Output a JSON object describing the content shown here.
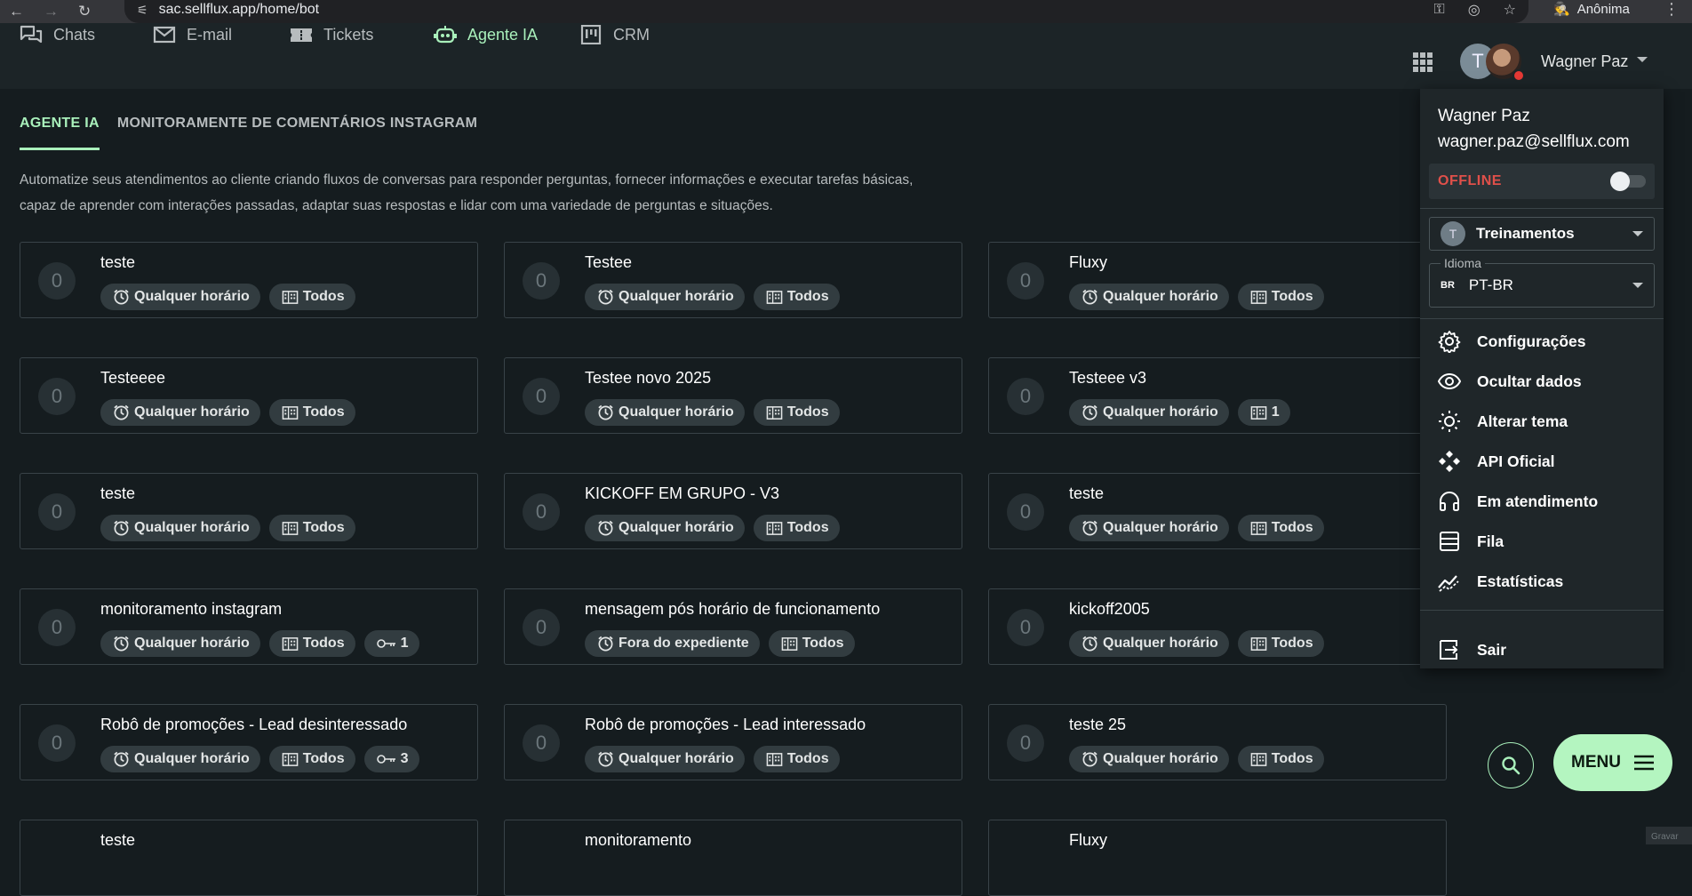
{
  "browser": {
    "url": "sac.sellflux.app/home/bot",
    "incognito_label": "Anônima"
  },
  "nav": {
    "items": [
      {
        "label": "Chats",
        "icon": "chat-icon"
      },
      {
        "label": "E-mail",
        "icon": "mail-icon"
      },
      {
        "label": "Tickets",
        "icon": "ticket-icon"
      },
      {
        "label": "Agente IA",
        "icon": "robot-icon",
        "active": true
      },
      {
        "label": "CRM",
        "icon": "kanban-icon"
      }
    ],
    "user_initial": "T",
    "user_name": "Wagner Paz"
  },
  "tabs": [
    {
      "label": "AGENTE IA",
      "active": true
    },
    {
      "label": "MONITORAMENTE DE COMENTÁRIOS INSTAGRAM",
      "active": false
    }
  ],
  "description": {
    "line1": "Automatize seus atendimentos ao cliente criando fluxos de conversas para responder perguntas, fornecer informações e executar tarefas básicas,",
    "line2": "capaz de aprender com interações passadas, adaptar suas respostas e lidar com uma variedade de perguntas e situações."
  },
  "cards": [
    {
      "count": "0",
      "name": "teste",
      "schedule": "Qualquer horário",
      "scope": "Todos",
      "keys": null
    },
    {
      "count": "0",
      "name": "Testee",
      "schedule": "Qualquer horário",
      "scope": "Todos",
      "keys": null
    },
    {
      "count": "0",
      "name": "Fluxy",
      "schedule": "Qualquer horário",
      "scope": "Todos",
      "keys": null
    },
    {
      "count": "0",
      "name": "Testeeee",
      "schedule": "Qualquer horário",
      "scope": "Todos",
      "keys": null
    },
    {
      "count": "0",
      "name": "Testee novo 2025",
      "schedule": "Qualquer horário",
      "scope": "Todos",
      "keys": null
    },
    {
      "count": "0",
      "name": "Testeee v3",
      "schedule": "Qualquer horário",
      "scope": "1",
      "keys": null
    },
    {
      "count": "0",
      "name": "teste",
      "schedule": "Qualquer horário",
      "scope": "Todos",
      "keys": null
    },
    {
      "count": "0",
      "name": "KICKOFF EM GRUPO - V3",
      "schedule": "Qualquer horário",
      "scope": "Todos",
      "keys": null
    },
    {
      "count": "0",
      "name": "teste",
      "schedule": "Qualquer horário",
      "scope": "Todos",
      "keys": null
    },
    {
      "count": "0",
      "name": "monitoramento instagram",
      "schedule": "Qualquer horário",
      "scope": "Todos",
      "keys": "1"
    },
    {
      "count": "0",
      "name": "mensagem pós horário de funcionamento",
      "schedule": "Fora do expediente",
      "scope": "Todos",
      "keys": null
    },
    {
      "count": "0",
      "name": "kickoff2005",
      "schedule": "Qualquer horário",
      "scope": "Todos",
      "keys": null
    },
    {
      "count": "0",
      "name": "Robô de promoções - Lead desinteressado",
      "schedule": "Qualquer horário",
      "scope": "Todos",
      "keys": "3"
    },
    {
      "count": "0",
      "name": "Robô de promoções - Lead interessado",
      "schedule": "Qualquer horário",
      "scope": "Todos",
      "keys": null
    },
    {
      "count": "0",
      "name": "teste 25",
      "schedule": "Qualquer horário",
      "scope": "Todos",
      "keys": null
    },
    {
      "count": "",
      "name": "teste",
      "schedule": "",
      "scope": "",
      "keys": null
    },
    {
      "count": "",
      "name": "monitoramento",
      "schedule": "",
      "scope": "",
      "keys": null
    },
    {
      "count": "",
      "name": "Fluxy",
      "schedule": "",
      "scope": "",
      "keys": null
    }
  ],
  "user_menu": {
    "name": "Wagner Paz",
    "email": "wagner.paz@sellflux.com",
    "status_label": "OFFLINE",
    "online": false,
    "team_initial": "T",
    "team": "Treinamentos",
    "language_legend": "Idioma",
    "language_flag": "BR",
    "language": "PT-BR",
    "items": [
      {
        "label": "Configurações",
        "icon": "gear-icon"
      },
      {
        "label": "Ocultar dados",
        "icon": "eye-icon"
      },
      {
        "label": "Alterar tema",
        "icon": "sun-icon"
      },
      {
        "label": "API Oficial",
        "icon": "api-icon"
      },
      {
        "label": "Em atendimento",
        "icon": "headset-icon"
      },
      {
        "label": "Fila",
        "icon": "queue-icon"
      },
      {
        "label": "Estatísticas",
        "icon": "chart-icon"
      }
    ],
    "logout": "Sair"
  },
  "fab": {
    "menu_label": "MENU"
  },
  "recorder_label": "Gravar",
  "colors": {
    "accent": "#a9f0bb",
    "background": "#151c1f",
    "offline": "#e0504a"
  }
}
